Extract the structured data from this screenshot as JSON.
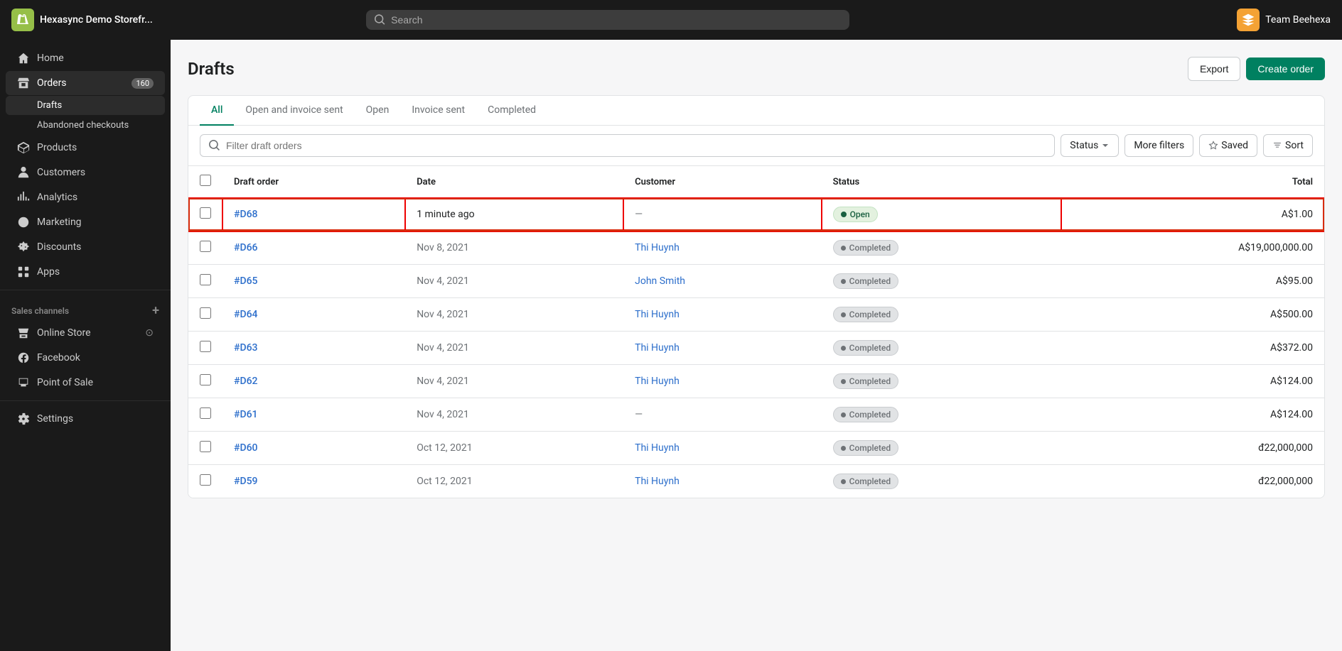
{
  "topNav": {
    "storeName": "Hexasync Demo Storefr...",
    "searchPlaceholder": "Search",
    "userName": "Team Beehexa"
  },
  "sidebar": {
    "items": [
      {
        "id": "home",
        "label": "Home",
        "icon": "home-icon",
        "active": false
      },
      {
        "id": "orders",
        "label": "Orders",
        "icon": "orders-icon",
        "badge": "160",
        "active": true
      },
      {
        "id": "drafts",
        "label": "Drafts",
        "icon": null,
        "sub": true,
        "active": true
      },
      {
        "id": "abandoned-checkouts",
        "label": "Abandoned checkouts",
        "icon": null,
        "sub": true,
        "active": false
      },
      {
        "id": "products",
        "label": "Products",
        "icon": "products-icon",
        "active": false
      },
      {
        "id": "customers",
        "label": "Customers",
        "icon": "customers-icon",
        "active": false
      },
      {
        "id": "analytics",
        "label": "Analytics",
        "icon": "analytics-icon",
        "active": false
      },
      {
        "id": "marketing",
        "label": "Marketing",
        "icon": "marketing-icon",
        "active": false
      },
      {
        "id": "discounts",
        "label": "Discounts",
        "icon": "discounts-icon",
        "active": false
      },
      {
        "id": "apps",
        "label": "Apps",
        "icon": "apps-icon",
        "active": false
      }
    ],
    "salesChannels": {
      "label": "Sales channels",
      "channels": [
        {
          "id": "online-store",
          "label": "Online Store",
          "icon": "store-icon"
        },
        {
          "id": "facebook",
          "label": "Facebook",
          "icon": "facebook-icon"
        },
        {
          "id": "point-of-sale",
          "label": "Point of Sale",
          "icon": "pos-icon"
        }
      ]
    },
    "settings": "Settings"
  },
  "page": {
    "title": "Drafts",
    "exportLabel": "Export",
    "createOrderLabel": "Create order"
  },
  "tabs": [
    {
      "id": "all",
      "label": "All",
      "active": true
    },
    {
      "id": "open-invoice",
      "label": "Open and invoice sent",
      "active": false
    },
    {
      "id": "open",
      "label": "Open",
      "active": false
    },
    {
      "id": "invoice-sent",
      "label": "Invoice sent",
      "active": false
    },
    {
      "id": "completed",
      "label": "Completed",
      "active": false
    }
  ],
  "filters": {
    "searchPlaceholder": "Filter draft orders",
    "statusLabel": "Status",
    "moreFiltersLabel": "More filters",
    "savedLabel": "Saved",
    "sortLabel": "Sort"
  },
  "table": {
    "columns": [
      {
        "id": "draft-order",
        "label": "Draft order"
      },
      {
        "id": "date",
        "label": "Date"
      },
      {
        "id": "customer",
        "label": "Customer"
      },
      {
        "id": "status",
        "label": "Status"
      },
      {
        "id": "total",
        "label": "Total",
        "align": "right"
      }
    ],
    "rows": [
      {
        "id": "d68",
        "order": "#D68",
        "date": "1 minute ago",
        "customer": null,
        "status": "Open",
        "statusType": "open",
        "total": "A$1.00",
        "highlighted": true
      },
      {
        "id": "d66",
        "order": "#D66",
        "date": "Nov 8, 2021",
        "customer": "Thi Huynh",
        "status": "Completed",
        "statusType": "completed",
        "total": "A$19,000,000.00",
        "highlighted": false
      },
      {
        "id": "d65",
        "order": "#D65",
        "date": "Nov 4, 2021",
        "customer": "John Smith",
        "status": "Completed",
        "statusType": "completed",
        "total": "A$95.00",
        "highlighted": false
      },
      {
        "id": "d64",
        "order": "#D64",
        "date": "Nov 4, 2021",
        "customer": "Thi Huynh",
        "status": "Completed",
        "statusType": "completed",
        "total": "A$500.00",
        "highlighted": false
      },
      {
        "id": "d63",
        "order": "#D63",
        "date": "Nov 4, 2021",
        "customer": "Thi Huynh",
        "status": "Completed",
        "statusType": "completed",
        "total": "A$372.00",
        "highlighted": false
      },
      {
        "id": "d62",
        "order": "#D62",
        "date": "Nov 4, 2021",
        "customer": "Thi Huynh",
        "status": "Completed",
        "statusType": "completed",
        "total": "A$124.00",
        "highlighted": false
      },
      {
        "id": "d61",
        "order": "#D61",
        "date": "Nov 4, 2021",
        "customer": null,
        "status": "Completed",
        "statusType": "completed",
        "total": "A$124.00",
        "highlighted": false
      },
      {
        "id": "d60",
        "order": "#D60",
        "date": "Oct 12, 2021",
        "customer": "Thi Huynh",
        "status": "Completed",
        "statusType": "completed",
        "total": "đ22,000,000",
        "highlighted": false
      },
      {
        "id": "d59",
        "order": "#D59",
        "date": "Oct 12, 2021",
        "customer": "Thi Huynh",
        "status": "Completed",
        "statusType": "completed",
        "total": "đ22,000,000",
        "highlighted": false
      }
    ]
  }
}
